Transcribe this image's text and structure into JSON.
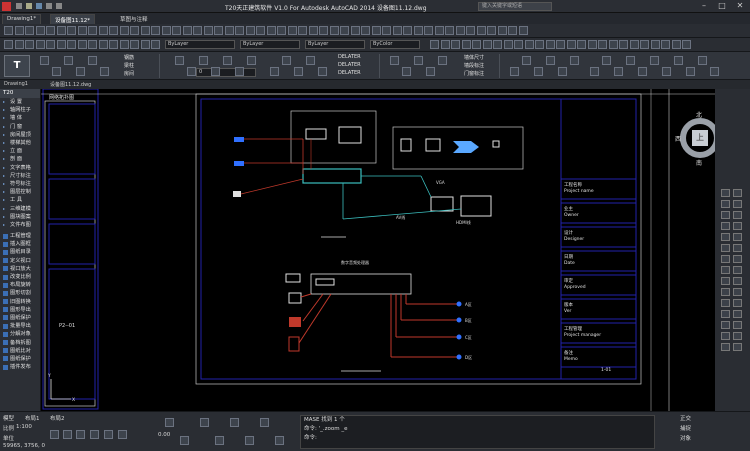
{
  "window": {
    "title": "T20天正建筑软件 V1.0 For Autodesk AutoCAD 2014    设备图11.12.dwg",
    "search_placeholder": "键入关键字或短语"
  },
  "tabs": {
    "drawing1": "Drawing1*",
    "active": "设备图11.12*",
    "menu": "草图与注释"
  },
  "toolbar": {
    "layer_value": "ByLayer",
    "linetype_value": "ByLayer",
    "lineweight_value": "ByLayer",
    "color_value": "ByColor",
    "plot_style": "ByColor"
  },
  "ribbon": {
    "groups": [
      {
        "buttons": [
          "钢筋",
          "梁柱",
          "房间"
        ]
      },
      {
        "buttons": [
          "DELATER",
          "DELATER",
          "DELATER"
        ]
      },
      {
        "buttons": [
          "墙体尺寸",
          "墙段标注",
          "门窗标注"
        ]
      }
    ],
    "layer_dd": "0"
  },
  "doc_tab": {
    "name": "Drawing1",
    "file": "设备图11.12.dwg"
  },
  "left_panel": {
    "title": "T20",
    "items": [
      {
        "label": "设  置",
        "icon": false
      },
      {
        "label": "轴网柱子",
        "icon": false
      },
      {
        "label": "墙  体",
        "icon": false
      },
      {
        "label": "门  窗",
        "icon": false
      },
      {
        "label": "房间屋顶",
        "icon": false
      },
      {
        "label": "楼梯其他",
        "icon": false
      },
      {
        "label": "立  面",
        "icon": false
      },
      {
        "label": "剖  面",
        "icon": false
      },
      {
        "label": "文字表格",
        "icon": false
      },
      {
        "label": "尺寸标注",
        "icon": false
      },
      {
        "label": "符号标注",
        "icon": false
      },
      {
        "label": "图层控制",
        "icon": false
      },
      {
        "label": "工  具",
        "icon": false
      },
      {
        "label": "三维建模",
        "icon": false
      },
      {
        "label": "图块图案",
        "icon": false
      },
      {
        "label": "文件布图",
        "icon": false
      },
      {
        "label": "工程管理",
        "icon": true
      },
      {
        "label": "插入图框",
        "icon": true
      },
      {
        "label": "图纸目录",
        "icon": true
      },
      {
        "label": "定义视口",
        "icon": true
      },
      {
        "label": "视口放大",
        "icon": true
      },
      {
        "label": "改变比例",
        "icon": true
      },
      {
        "label": "布局旋转",
        "icon": true
      },
      {
        "label": "图形切割",
        "icon": true
      },
      {
        "label": "旧图转换",
        "icon": true
      },
      {
        "label": "图形导出",
        "icon": true
      },
      {
        "label": "图纸保护",
        "icon": true
      },
      {
        "label": "批量导出",
        "icon": true
      },
      {
        "label": "分解对象",
        "icon": true
      },
      {
        "label": "备档拆图",
        "icon": true
      },
      {
        "label": "图纸比对",
        "icon": true
      },
      {
        "label": "图纸保护",
        "icon": true
      },
      {
        "label": "插件发布",
        "icon": true
      }
    ]
  },
  "drawing": {
    "header_label": "网络拓扑图",
    "left_frame_label": "P2--01",
    "section_labels": {
      "top": "───",
      "middle": "───",
      "bottom": "───"
    },
    "title_block": [
      {
        "cn": "工程名称",
        "en": "Project name"
      },
      {
        "cn": "业主",
        "en": "Owner"
      },
      {
        "cn": "设计",
        "en": "Designer"
      },
      {
        "cn": "日期",
        "en": "Date"
      },
      {
        "cn": "审定",
        "en": "Approved"
      },
      {
        "cn": "版本",
        "en": "Ver"
      },
      {
        "cn": "工程管理",
        "en": "Project manager"
      },
      {
        "cn": "备注",
        "en": "Memo"
      }
    ],
    "page_no": "1-01",
    "av_labels": [
      "AV线",
      "HDMI线"
    ],
    "amp_label": "数字音频处理器",
    "speakers": [
      "A区",
      "B区",
      "C区",
      "D区"
    ],
    "switch_label": "交换机",
    "vga_label": "VGA",
    "axis_x": "X",
    "axis_y": "Y"
  },
  "viewcube": {
    "north": "北",
    "west": "西",
    "south": "南",
    "face": "上"
  },
  "bottom": {
    "model_tabs": [
      "模型",
      "布局1",
      "布局2"
    ],
    "scale_label": "比例",
    "scale_value": "1:100",
    "unit_label": "单位",
    "coords": "59965, 3756, 0",
    "elevation": "0.00",
    "cmd_line1": "MASE 找到 1 个",
    "cmd_line2": "命令: '_.zoom _e",
    "cmd_input": "命令:",
    "right_items": [
      "正交",
      "捕捉",
      "对象"
    ]
  }
}
